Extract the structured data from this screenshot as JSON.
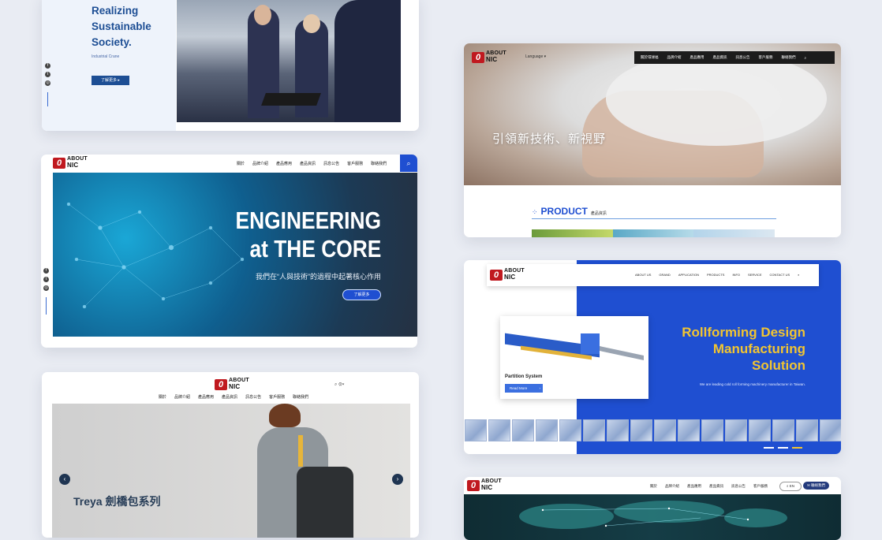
{
  "card1": {
    "headline_lines": [
      "Realizing",
      "Sustainable",
      "Society."
    ],
    "subtitle": "Industrial Crane",
    "button": "了解更多"
  },
  "card2": {
    "logo_top": "ABOUT",
    "logo_bottom": "NIC",
    "nav": [
      "關於",
      "品牌介紹",
      "產品應用",
      "產品資訊",
      "訊息公告",
      "客戶服務",
      "聯絡我們"
    ],
    "headline_1": "ENGINEERING",
    "headline_2": "at THE CORE",
    "tagline": "我們在“人與技術”的過程中起著核心作用",
    "button": "了解更多"
  },
  "card3": {
    "logo_top": "ABOUT",
    "logo_bottom": "NIC",
    "nav": [
      "關於",
      "品牌介紹",
      "產品應用",
      "產品資訊",
      "訊息公告",
      "客戶服務",
      "聯絡我們"
    ],
    "title": "Treya 劍橋包系列"
  },
  "card4": {
    "logo_top": "ABOUT",
    "logo_bottom": "NIC",
    "language": "Language",
    "nav": [
      "關於環球福",
      "品牌介紹",
      "產品應用",
      "產品資訊",
      "訊息公告",
      "客戶服務",
      "聯絡我們"
    ],
    "headline": "引領新技術、新視野",
    "section_title": "PRODUCT",
    "section_sub": "產品資訊"
  },
  "card5": {
    "logo_top": "ABOUT",
    "logo_bottom": "NIC",
    "nav": [
      "ABOUT US",
      "GRAND",
      "APPLICATION",
      "PRODUCTS",
      "INFO",
      "SERVICE",
      "CONTACT US"
    ],
    "product_label": "Partition System",
    "read_more": "Read More",
    "headline_1": "Rollforming Design",
    "headline_2": "Manufacturing",
    "headline_3": "Solution",
    "tagline": "We are leading cold roll forming machinery manufacturer in Taiwan."
  },
  "card6": {
    "logo_top": "ABOUT",
    "logo_bottom": "NIC",
    "nav": [
      "關於",
      "品牌介紹",
      "產品應用",
      "產品資訊",
      "訊息公告",
      "客戶服務"
    ],
    "btn_en": "EN",
    "btn_contact": "聯絡我們"
  },
  "colors": {
    "accent_blue": "#1f4fd1",
    "brand_red": "#c0191f",
    "yellow": "#f2c531",
    "navy": "#233a7c"
  }
}
